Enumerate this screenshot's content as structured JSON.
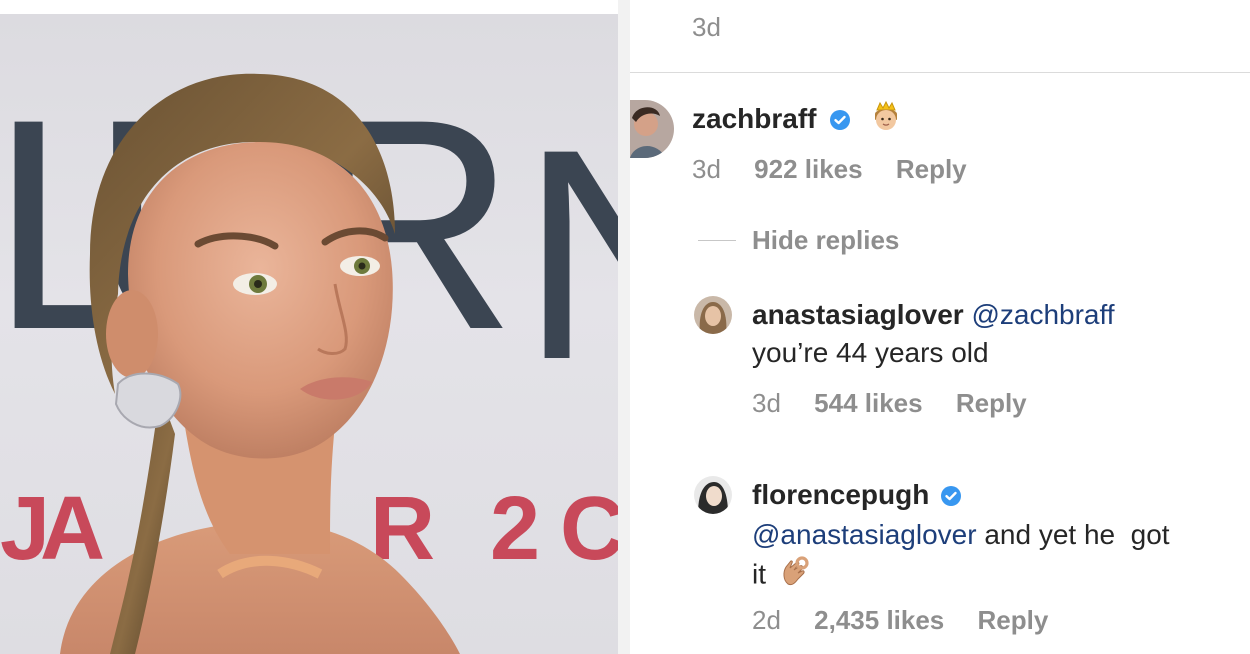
{
  "top_comment": {
    "time": "3d"
  },
  "comments": [
    {
      "username": "zachbraff",
      "verified": true,
      "emoji": "crown-face-emoji",
      "time": "3d",
      "likes": "922 likes",
      "reply": "Reply",
      "hide_replies": "Hide replies"
    },
    {
      "username": "anastasiaglover",
      "mention": "@zachbraff",
      "text": "you’re 44 years old",
      "time": "3d",
      "likes": "544 likes",
      "reply": "Reply"
    },
    {
      "username": "florencepugh",
      "verified": true,
      "mention": "@anastasiaglover",
      "text_line1": "and yet he  got",
      "text_line2": "it",
      "emoji": "ok-hand-emoji",
      "time": "2d",
      "likes": "2,435 likes",
      "reply": "Reply"
    }
  ],
  "photo": {
    "backdrop_letters": [
      "L",
      "U",
      "R",
      "N"
    ],
    "backdrop_red": [
      "J",
      "A",
      "R",
      "2",
      "C"
    ]
  },
  "colors": {
    "verified_blue": "#3897f0",
    "mention": "#1d3e7a",
    "meta_gray": "#8e8e8e",
    "text": "#262626"
  }
}
